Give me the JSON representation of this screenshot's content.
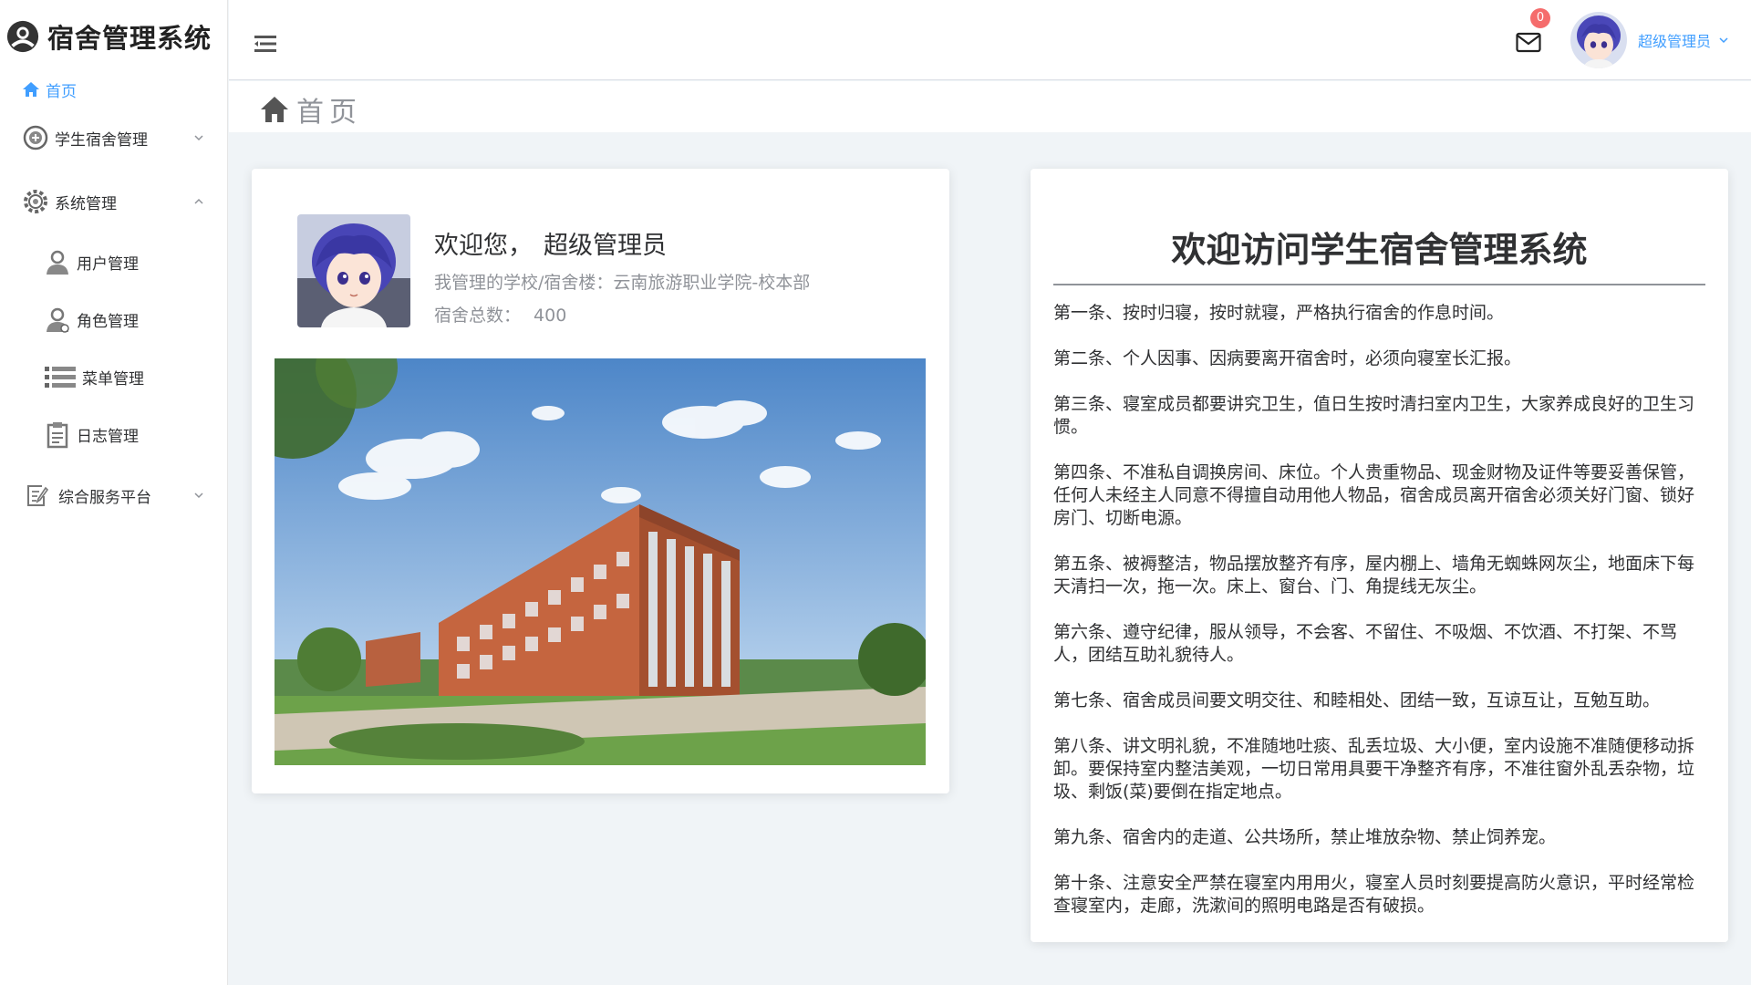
{
  "app": {
    "title": "宿舍管理系统"
  },
  "sidebar": {
    "home_label": "首页",
    "items": [
      {
        "label": "学生宿舍管理",
        "icon": "circle-plus-icon",
        "expanded": false
      },
      {
        "label": "系统管理",
        "icon": "gear-icon",
        "expanded": true,
        "children": [
          {
            "label": "用户管理",
            "icon": "user-icon"
          },
          {
            "label": "角色管理",
            "icon": "user-role-icon"
          },
          {
            "label": "菜单管理",
            "icon": "list-icon"
          },
          {
            "label": "日志管理",
            "icon": "clipboard-icon"
          }
        ]
      },
      {
        "label": "综合服务平台",
        "icon": "edit-doc-icon",
        "expanded": false
      }
    ]
  },
  "header": {
    "notification_count": "0",
    "username": "超级管理员"
  },
  "page": {
    "title": "首页"
  },
  "welcome_card": {
    "greeting": "欢迎您，",
    "name": "超级管理员",
    "school_line": "我管理的学校/宿舍楼：云南旅游职业学院-校本部",
    "dorm_total_label": "宿舍总数：",
    "dorm_total_value": "400"
  },
  "notice": {
    "title": "欢迎访问学生宿舍管理系统",
    "rules": [
      "第一条、按时归寝，按时就寝，严格执行宿舍的作息时间。",
      "第二条、个人因事、因病要离开宿舍时，必须向寝室长汇报。",
      "第三条、寝室成员都要讲究卫生，值日生按时清扫室内卫生，大家养成良好的卫生习惯。",
      "第四条、不准私自调换房间、床位。个人贵重物品、现金财物及证件等要妥善保管，任何人未经主人同意不得擅自动用他人物品，宿舍成员离开宿舍必须关好门窗、锁好房门、切断电源。",
      "第五条、被褥整洁，物品摆放整齐有序，屋内棚上、墙角无蜘蛛网灰尘，地面床下每天清扫一次，拖一次。床上、窗台、门、角提线无灰尘。",
      "第六条、遵守纪律，服从领导，不会客、不留住、不吸烟、不饮酒、不打架、不骂人，团结互助礼貌待人。",
      "第七条、宿舍成员间要文明交往、和睦相处、团结一致，互谅互让，互勉互助。",
      "第八条、讲文明礼貌，不准随地吐痰、乱丢垃圾、大小便，室内设施不准随便移动拆卸。要保持室内整洁美观，一切日常用具要干净整齐有序，不准往窗外乱丢杂物，垃圾、剩饭(菜)要倒在指定地点。",
      "第九条、宿舍内的走道、公共场所，禁止堆放杂物、禁止饲养宠。",
      "第十条、注意安全严禁在寝室内用用火，寝室人员时刻要提高防火意识，平时经常检查寝室内，走廊，洗漱间的照明电路是否有破损。"
    ]
  },
  "colors": {
    "accent": "#409eff",
    "badge": "#f56c6c",
    "background": "#f0f4f7"
  }
}
